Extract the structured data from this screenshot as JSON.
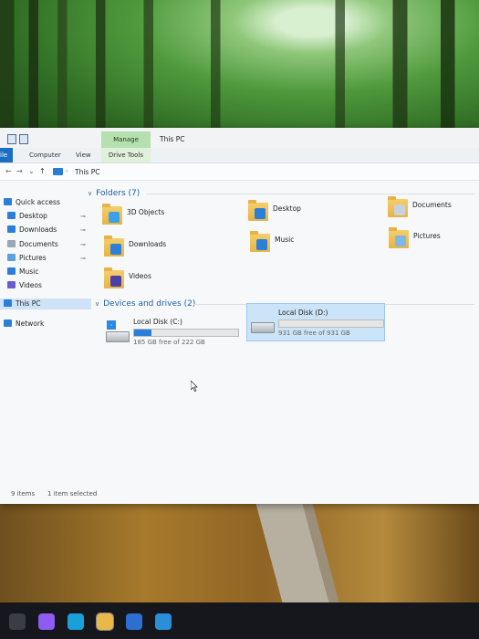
{
  "window": {
    "quick_access_icons": [
      "properties-icon",
      "new-folder-icon"
    ],
    "manage_tab": "Manage",
    "title": "This PC"
  },
  "ribbon": {
    "file": "ile",
    "computer": "Computer",
    "view": "View",
    "drive_tools": "Drive Tools"
  },
  "address": {
    "path": "This PC"
  },
  "sidebar": {
    "items": [
      {
        "label": "Quick access",
        "icon": "star-icon",
        "color": "#2b7fd8",
        "pinned": false
      },
      {
        "label": "Desktop",
        "icon": "desktop-icon",
        "color": "#2b7fd8",
        "pinned": true
      },
      {
        "label": "Downloads",
        "icon": "download-icon",
        "color": "#2b7fd8",
        "pinned": true
      },
      {
        "label": "Documents",
        "icon": "documents-icon",
        "color": "#9aa7b5",
        "pinned": true
      },
      {
        "label": "Pictures",
        "icon": "pictures-icon",
        "color": "#5ba0e0",
        "pinned": true
      },
      {
        "label": "Music",
        "icon": "music-icon",
        "color": "#2b7fd8",
        "pinned": false
      },
      {
        "label": "Videos",
        "icon": "videos-icon",
        "color": "#6b5ccc",
        "pinned": false
      },
      {
        "label": "This PC",
        "icon": "this-pc-icon",
        "color": "#2b7fd8",
        "pinned": false,
        "selected": true
      },
      {
        "label": "Network",
        "icon": "network-icon",
        "color": "#2b7fd8",
        "pinned": false
      }
    ]
  },
  "folders": {
    "heading": "Folders (7)",
    "items": [
      {
        "label": "3D Objects",
        "overlay_color": "#3aa0e8"
      },
      {
        "label": "Desktop",
        "overlay_color": "#2b7fd8"
      },
      {
        "label": "Documents",
        "overlay_color": "#c9d2dc"
      },
      {
        "label": "Downloads",
        "overlay_color": "#2b7fd8"
      },
      {
        "label": "Music",
        "overlay_color": "#2b7fd8"
      },
      {
        "label": "Pictures",
        "overlay_color": "#7fb8e6"
      },
      {
        "label": "Videos",
        "overlay_color": "#4b3fa6"
      }
    ]
  },
  "drives": {
    "heading": "Devices and drives (2)",
    "items": [
      {
        "name": "Local Disk (C:)",
        "free": "185 GB free of 222 GB",
        "used_fraction": 0.17,
        "selected": false
      },
      {
        "name": "Local Disk (D:)",
        "free": "931 GB free of 931 GB",
        "used_fraction": 0.0,
        "selected": true
      }
    ]
  },
  "status": {
    "items_count": "9 items",
    "selected": "1 item selected"
  },
  "taskbar": {
    "icons": [
      {
        "name": "task-view-icon",
        "color": "#3a3d44"
      },
      {
        "name": "copilot-icon",
        "color": "#8e5cf0"
      },
      {
        "name": "edge-icon",
        "color": "#1a9fd9"
      },
      {
        "name": "file-explorer-icon",
        "color": "#e8b94a"
      },
      {
        "name": "microsoft-store-icon",
        "color": "#2d6fd0"
      },
      {
        "name": "mail-icon",
        "color": "#2a8fd8"
      }
    ]
  }
}
